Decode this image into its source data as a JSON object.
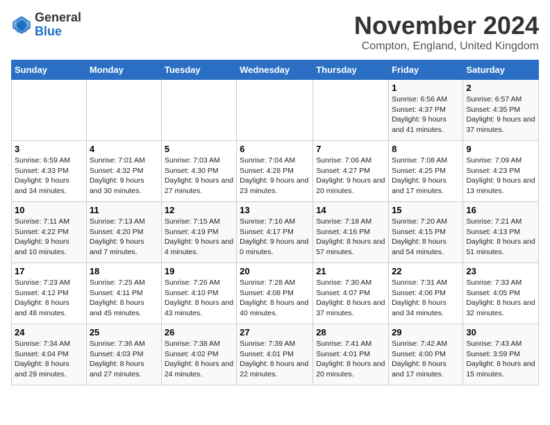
{
  "header": {
    "logo_line1": "General",
    "logo_line2": "Blue",
    "month": "November 2024",
    "location": "Compton, England, United Kingdom"
  },
  "columns": [
    "Sunday",
    "Monday",
    "Tuesday",
    "Wednesday",
    "Thursday",
    "Friday",
    "Saturday"
  ],
  "weeks": [
    [
      {
        "day": "",
        "info": ""
      },
      {
        "day": "",
        "info": ""
      },
      {
        "day": "",
        "info": ""
      },
      {
        "day": "",
        "info": ""
      },
      {
        "day": "",
        "info": ""
      },
      {
        "day": "1",
        "info": "Sunrise: 6:56 AM\nSunset: 4:37 PM\nDaylight: 9 hours and 41 minutes."
      },
      {
        "day": "2",
        "info": "Sunrise: 6:57 AM\nSunset: 4:35 PM\nDaylight: 9 hours and 37 minutes."
      }
    ],
    [
      {
        "day": "3",
        "info": "Sunrise: 6:59 AM\nSunset: 4:33 PM\nDaylight: 9 hours and 34 minutes."
      },
      {
        "day": "4",
        "info": "Sunrise: 7:01 AM\nSunset: 4:32 PM\nDaylight: 9 hours and 30 minutes."
      },
      {
        "day": "5",
        "info": "Sunrise: 7:03 AM\nSunset: 4:30 PM\nDaylight: 9 hours and 27 minutes."
      },
      {
        "day": "6",
        "info": "Sunrise: 7:04 AM\nSunset: 4:28 PM\nDaylight: 9 hours and 23 minutes."
      },
      {
        "day": "7",
        "info": "Sunrise: 7:06 AM\nSunset: 4:27 PM\nDaylight: 9 hours and 20 minutes."
      },
      {
        "day": "8",
        "info": "Sunrise: 7:08 AM\nSunset: 4:25 PM\nDaylight: 9 hours and 17 minutes."
      },
      {
        "day": "9",
        "info": "Sunrise: 7:09 AM\nSunset: 4:23 PM\nDaylight: 9 hours and 13 minutes."
      }
    ],
    [
      {
        "day": "10",
        "info": "Sunrise: 7:11 AM\nSunset: 4:22 PM\nDaylight: 9 hours and 10 minutes."
      },
      {
        "day": "11",
        "info": "Sunrise: 7:13 AM\nSunset: 4:20 PM\nDaylight: 9 hours and 7 minutes."
      },
      {
        "day": "12",
        "info": "Sunrise: 7:15 AM\nSunset: 4:19 PM\nDaylight: 9 hours and 4 minutes."
      },
      {
        "day": "13",
        "info": "Sunrise: 7:16 AM\nSunset: 4:17 PM\nDaylight: 9 hours and 0 minutes."
      },
      {
        "day": "14",
        "info": "Sunrise: 7:18 AM\nSunset: 4:16 PM\nDaylight: 8 hours and 57 minutes."
      },
      {
        "day": "15",
        "info": "Sunrise: 7:20 AM\nSunset: 4:15 PM\nDaylight: 8 hours and 54 minutes."
      },
      {
        "day": "16",
        "info": "Sunrise: 7:21 AM\nSunset: 4:13 PM\nDaylight: 8 hours and 51 minutes."
      }
    ],
    [
      {
        "day": "17",
        "info": "Sunrise: 7:23 AM\nSunset: 4:12 PM\nDaylight: 8 hours and 48 minutes."
      },
      {
        "day": "18",
        "info": "Sunrise: 7:25 AM\nSunset: 4:11 PM\nDaylight: 8 hours and 45 minutes."
      },
      {
        "day": "19",
        "info": "Sunrise: 7:26 AM\nSunset: 4:10 PM\nDaylight: 8 hours and 43 minutes."
      },
      {
        "day": "20",
        "info": "Sunrise: 7:28 AM\nSunset: 4:08 PM\nDaylight: 8 hours and 40 minutes."
      },
      {
        "day": "21",
        "info": "Sunrise: 7:30 AM\nSunset: 4:07 PM\nDaylight: 8 hours and 37 minutes."
      },
      {
        "day": "22",
        "info": "Sunrise: 7:31 AM\nSunset: 4:06 PM\nDaylight: 8 hours and 34 minutes."
      },
      {
        "day": "23",
        "info": "Sunrise: 7:33 AM\nSunset: 4:05 PM\nDaylight: 8 hours and 32 minutes."
      }
    ],
    [
      {
        "day": "24",
        "info": "Sunrise: 7:34 AM\nSunset: 4:04 PM\nDaylight: 8 hours and 29 minutes."
      },
      {
        "day": "25",
        "info": "Sunrise: 7:36 AM\nSunset: 4:03 PM\nDaylight: 8 hours and 27 minutes."
      },
      {
        "day": "26",
        "info": "Sunrise: 7:38 AM\nSunset: 4:02 PM\nDaylight: 8 hours and 24 minutes."
      },
      {
        "day": "27",
        "info": "Sunrise: 7:39 AM\nSunset: 4:01 PM\nDaylight: 8 hours and 22 minutes."
      },
      {
        "day": "28",
        "info": "Sunrise: 7:41 AM\nSunset: 4:01 PM\nDaylight: 8 hours and 20 minutes."
      },
      {
        "day": "29",
        "info": "Sunrise: 7:42 AM\nSunset: 4:00 PM\nDaylight: 8 hours and 17 minutes."
      },
      {
        "day": "30",
        "info": "Sunrise: 7:43 AM\nSunset: 3:59 PM\nDaylight: 8 hours and 15 minutes."
      }
    ]
  ]
}
